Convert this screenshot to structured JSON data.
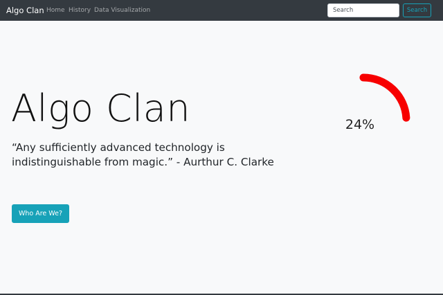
{
  "navbar": {
    "brand": "Algo Clan",
    "links": [
      {
        "label": "Home"
      },
      {
        "label": "History"
      },
      {
        "label": "Data Visualization"
      }
    ],
    "search": {
      "placeholder": "Search",
      "button_label": "Search"
    }
  },
  "hero": {
    "title": "Algo Clan",
    "quote": "“Any sufficiently advanced technology is indistinguishable from magic.” - Aurthur C. Clarke",
    "button_label": "Who Are We?"
  },
  "progress": {
    "value_label": "24%",
    "value": 0.24,
    "color": "#f70000"
  },
  "colors": {
    "navbar_bg": "#343a40",
    "page_bg": "#f8f9fa",
    "accent": "#17a2b8"
  }
}
